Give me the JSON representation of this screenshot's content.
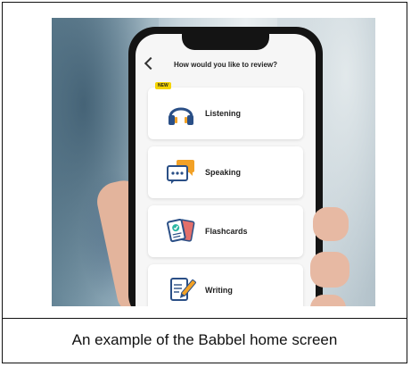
{
  "screen": {
    "header_title": "How would you like to review?",
    "items": [
      {
        "label": "Listening",
        "icon": "headphones-icon",
        "badge": "NEW"
      },
      {
        "label": "Speaking",
        "icon": "speech-bubbles-icon"
      },
      {
        "label": "Flashcards",
        "icon": "flashcards-icon"
      },
      {
        "label": "Writing",
        "icon": "writing-icon"
      }
    ]
  },
  "caption": "An example of the Babbel home screen",
  "colors": {
    "accent": "#f5d400",
    "icon_blue": "#2a4f86",
    "icon_orange": "#f2a126",
    "icon_teal": "#2bb6a3",
    "icon_red": "#e36f6a"
  }
}
